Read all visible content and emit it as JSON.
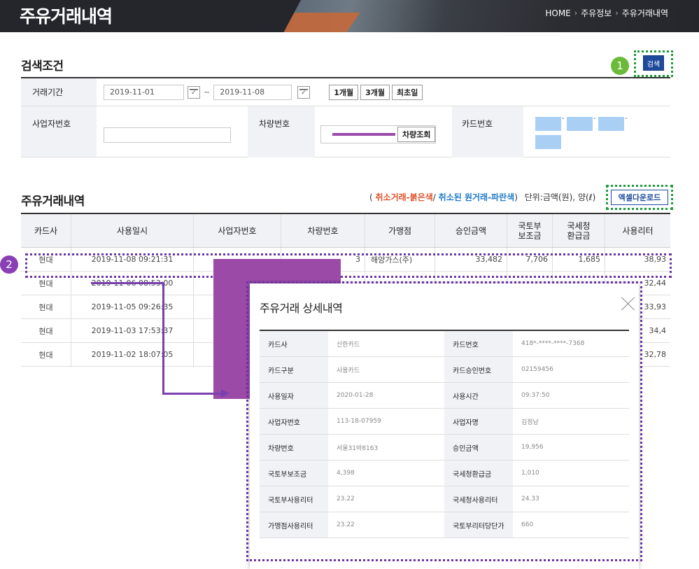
{
  "header": {
    "title": "주유거래내역",
    "breadcrumb": [
      "HOME",
      "주유정보",
      "주유거래내역"
    ]
  },
  "search": {
    "title": "검색조건",
    "search_button": "검색",
    "callout": "1",
    "period_label": "거래기간",
    "date_from": "2019-11-01",
    "date_to": "2019-11-08",
    "tilde": "~",
    "range_buttons": [
      "1개월",
      "3개월",
      "최초일"
    ],
    "biz_label": "사업자번호",
    "vehicle_label": "차량번호",
    "vehicle_lookup": "차량조회",
    "card_label": "카드번호",
    "card_dashes": [
      "-",
      "-",
      "-"
    ]
  },
  "results": {
    "title": "주유거래내역",
    "legend_open": "(",
    "legend_red": "취소거래-붉은색",
    "legend_slash": "/",
    "legend_blue": "취소된 원거래-파란색",
    "legend_close": ")",
    "unit": "단위:금액(원), 양(ℓ)",
    "excel_button": "엑셀다운로드",
    "callout": "2",
    "columns": [
      "카드사",
      "사용일시",
      "사업자번호",
      "차량번호",
      "가맹점",
      "승인금액",
      "국토부\n보조금",
      "국세청\n환급금",
      "사용리터"
    ],
    "rows": [
      {
        "card": "현대",
        "datetime": "2019-11-08 09:21:31",
        "biz": "",
        "vehicle": "3",
        "merchant": "해양가스(주)",
        "amount": "33,482",
        "subsidy": "7,706",
        "refund": "1,685",
        "liters": "38,93"
      },
      {
        "card": "현대",
        "datetime": "2019-11-06 08:53:00",
        "liters": "32,44"
      },
      {
        "card": "현대",
        "datetime": "2019-11-05 09:26:35",
        "liters": "33,93"
      },
      {
        "card": "현대",
        "datetime": "2019-11-03 17:53:37",
        "liters": "34,4"
      },
      {
        "card": "현대",
        "datetime": "2019-11-02 18:07:05",
        "liters": "32,78"
      }
    ]
  },
  "modal": {
    "title": "주유거래 상세내역",
    "rows": [
      [
        "카드사",
        "신한카드",
        "카드번호",
        "418*-****-****-7368"
      ],
      [
        "카드구분",
        "사용카드",
        "카드승인번호",
        "02159456"
      ],
      [
        "사용일자",
        "2020-01-28",
        "사용시간",
        "09:37:50"
      ],
      [
        "사업자번호",
        "113-18-07959",
        "사업자명",
        "김정남"
      ],
      [
        "차량번호",
        "서울31바8163",
        "승인금액",
        "19,956"
      ],
      [
        "국토부보조금",
        "4,398",
        "국세청환급금",
        "1,010"
      ],
      [
        "국토부사용리터",
        "23.22",
        "국세청사용리터",
        "24.33"
      ],
      [
        "가맹점사용리터",
        "23.22",
        "국토부리터당단가",
        "660"
      ]
    ]
  },
  "colors": {
    "header_bg": "#24262c",
    "primary": "#1f4a9c",
    "callout_green": "#6cba3c",
    "callout_purple": "#8a3fb5",
    "legend_red": "#e0542d",
    "legend_blue": "#1f7ac9"
  }
}
